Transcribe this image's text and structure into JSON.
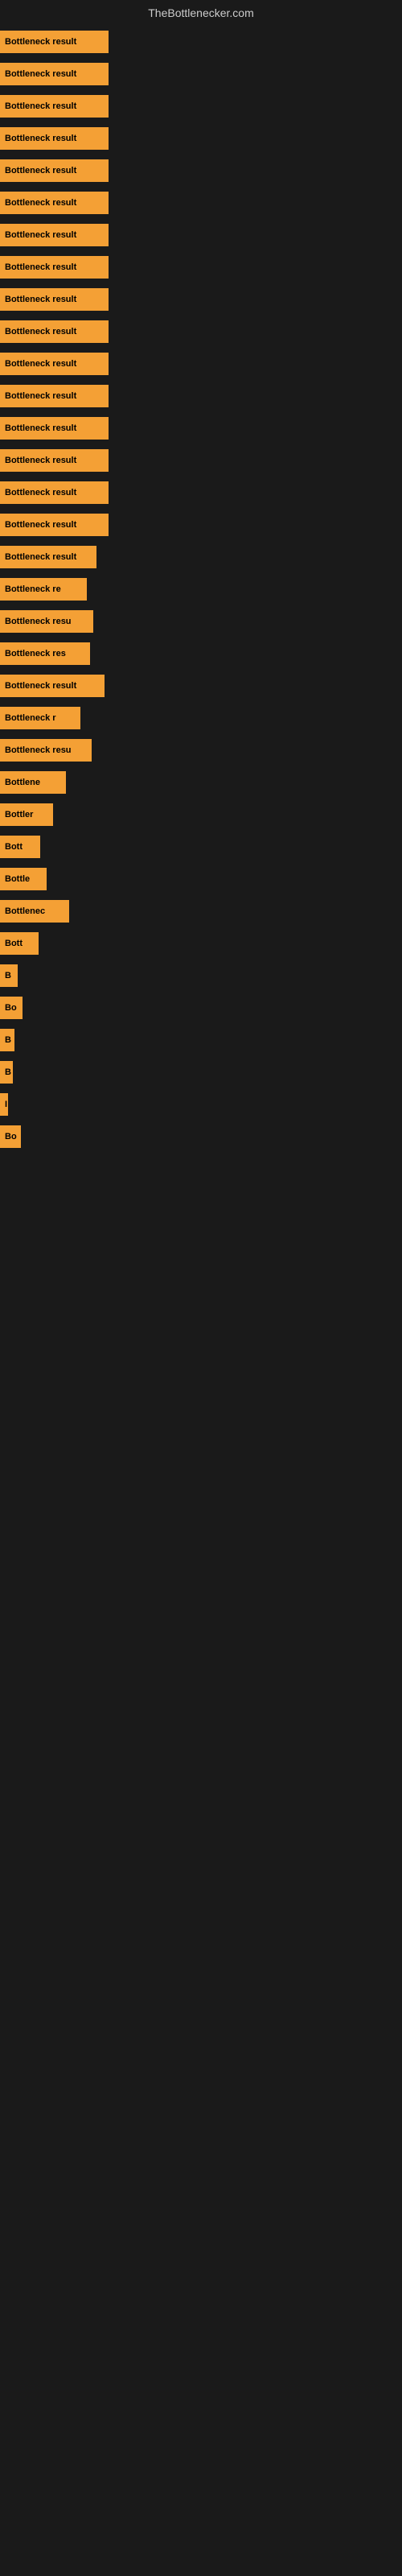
{
  "header": {
    "title": "TheBottlenecker.com"
  },
  "bars": [
    {
      "label": "Bottleneck result",
      "width": 135
    },
    {
      "label": "Bottleneck result",
      "width": 135
    },
    {
      "label": "Bottleneck result",
      "width": 135
    },
    {
      "label": "Bottleneck result",
      "width": 135
    },
    {
      "label": "Bottleneck result",
      "width": 135
    },
    {
      "label": "Bottleneck result",
      "width": 135
    },
    {
      "label": "Bottleneck result",
      "width": 135
    },
    {
      "label": "Bottleneck result",
      "width": 135
    },
    {
      "label": "Bottleneck result",
      "width": 135
    },
    {
      "label": "Bottleneck result",
      "width": 135
    },
    {
      "label": "Bottleneck result",
      "width": 135
    },
    {
      "label": "Bottleneck result",
      "width": 135
    },
    {
      "label": "Bottleneck result",
      "width": 135
    },
    {
      "label": "Bottleneck result",
      "width": 135
    },
    {
      "label": "Bottleneck result",
      "width": 135
    },
    {
      "label": "Bottleneck result",
      "width": 135
    },
    {
      "label": "Bottleneck result",
      "width": 120
    },
    {
      "label": "Bottleneck re",
      "width": 108
    },
    {
      "label": "Bottleneck resu",
      "width": 116
    },
    {
      "label": "Bottleneck res",
      "width": 112
    },
    {
      "label": "Bottleneck result",
      "width": 130
    },
    {
      "label": "Bottleneck r",
      "width": 100
    },
    {
      "label": "Bottleneck resu",
      "width": 114
    },
    {
      "label": "Bottlene",
      "width": 82
    },
    {
      "label": "Bottler",
      "width": 66
    },
    {
      "label": "Bott",
      "width": 50
    },
    {
      "label": "Bottle",
      "width": 58
    },
    {
      "label": "Bottlenec",
      "width": 86
    },
    {
      "label": "Bott",
      "width": 48
    },
    {
      "label": "B",
      "width": 22
    },
    {
      "label": "Bo",
      "width": 28
    },
    {
      "label": "B",
      "width": 18
    },
    {
      "label": "B",
      "width": 16
    },
    {
      "label": "I",
      "width": 10
    },
    {
      "label": "Bo",
      "width": 26
    }
  ]
}
